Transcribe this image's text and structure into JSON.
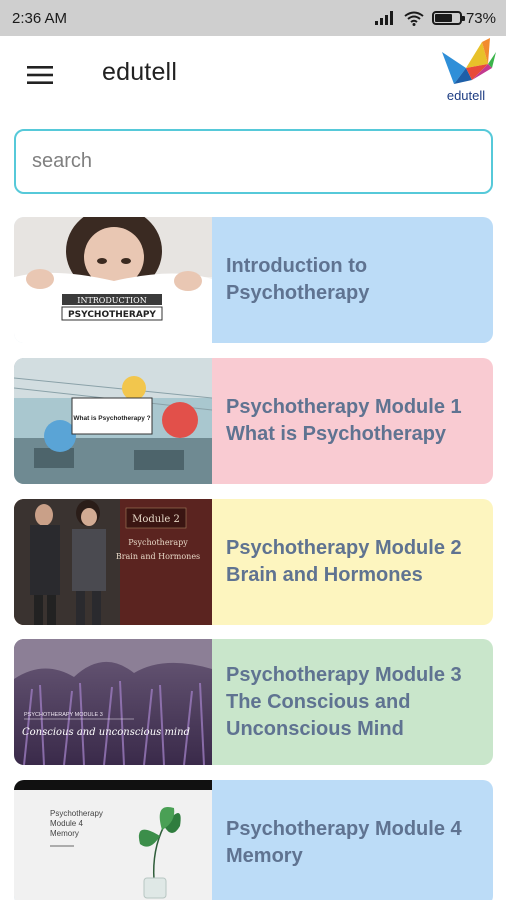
{
  "status_bar": {
    "time": "2:36 AM",
    "battery_percent": "73%",
    "battery_level": 0.73
  },
  "app_bar": {
    "title": "edutell",
    "logo_text": "edutell",
    "menu_icon": "hamburger-menu-icon"
  },
  "search": {
    "placeholder": "search",
    "value": ""
  },
  "courses": [
    {
      "title_line1": "Introduction to",
      "title_line2": "Psychotherapy",
      "title_line3": "",
      "bg_color": "#bcdcf7",
      "thumb_label1": "INTRODUCTION",
      "thumb_label2": "PSYCHOTHERAPY"
    },
    {
      "title_line1": "Psychotherapy Module 1",
      "title_line2": "What is Psychotherapy",
      "title_line3": "",
      "bg_color": "#f9cbd2",
      "thumb_label1": "What is Psychotherapy ?"
    },
    {
      "title_line1": "Psychotherapy Module 2",
      "title_line2": "Brain and Hormones",
      "title_line3": "",
      "bg_color": "#fdf5bf",
      "thumb_label1": "Module 2",
      "thumb_label2": "Psychotherapy",
      "thumb_label3": "Brain and Hormones"
    },
    {
      "title_line1": "Psychotherapy Module 3",
      "title_line2": "The Conscious and",
      "title_line3": "Unconscious Mind",
      "bg_color": "#c9e6cb",
      "thumb_label1": "PSYCHOTHERAPY MODULE 3",
      "thumb_label2": "Conscious and unconscious mind"
    },
    {
      "title_line1": "Psychotherapy Module 4",
      "title_line2": "Memory",
      "title_line3": "",
      "bg_color": "#bcdcf7",
      "thumb_label1": "Psychotherapy",
      "thumb_label2": "Module 4",
      "thumb_label3": "Memory"
    }
  ]
}
